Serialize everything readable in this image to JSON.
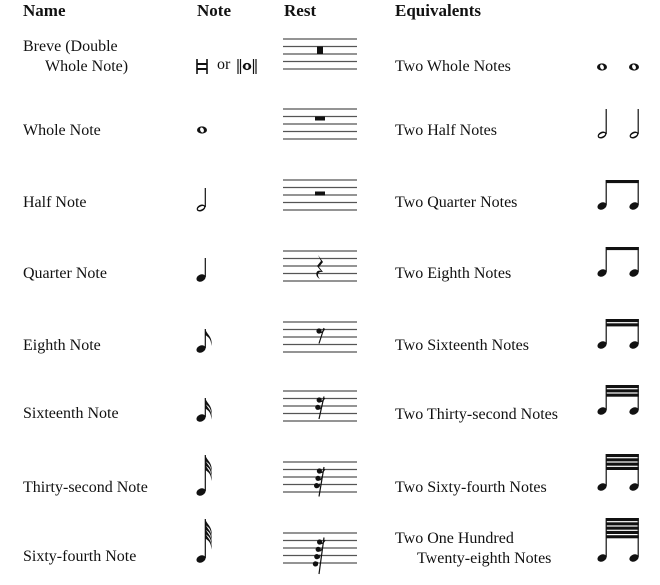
{
  "headers": {
    "name": "Name",
    "note": "Note",
    "rest": "Rest",
    "equivalents": "Equivalents"
  },
  "rows": [
    {
      "name_line1": "Breve (Double",
      "name_line2": "Whole Note)",
      "note_symbol": "breve-icon",
      "note_alt_connector": "or",
      "rest_symbol": "breve-rest-icon",
      "equivalent_line1": "Two Whole Notes",
      "equivalent_line2": "",
      "equivalent_symbol": "two-whole-notes-icon",
      "flags": -2
    },
    {
      "name_line1": "Whole Note",
      "name_line2": "",
      "note_symbol": "whole-note-icon",
      "rest_symbol": "whole-rest-icon",
      "equivalent_line1": "Two Half Notes",
      "equivalent_line2": "",
      "equivalent_symbol": "two-half-notes-icon",
      "flags": -1
    },
    {
      "name_line1": "Half Note",
      "name_line2": "",
      "note_symbol": "half-note-icon",
      "rest_symbol": "half-rest-icon",
      "equivalent_line1": "Two Quarter Notes",
      "equivalent_line2": "",
      "equivalent_symbol": "two-quarter-notes-icon",
      "flags": 0
    },
    {
      "name_line1": "Quarter Note",
      "name_line2": "",
      "note_symbol": "quarter-note-icon",
      "rest_symbol": "quarter-rest-icon",
      "equivalent_line1": "Two Eighth Notes",
      "equivalent_line2": "",
      "equivalent_symbol": "two-eighth-notes-icon",
      "flags": 0
    },
    {
      "name_line1": "Eighth Note",
      "name_line2": "",
      "note_symbol": "eighth-note-icon",
      "rest_symbol": "eighth-rest-icon",
      "equivalent_line1": "Two Sixteenth Notes",
      "equivalent_line2": "",
      "equivalent_symbol": "two-sixteenth-notes-icon",
      "flags": 1
    },
    {
      "name_line1": "Sixteenth Note",
      "name_line2": "",
      "note_symbol": "sixteenth-note-icon",
      "rest_symbol": "sixteenth-rest-icon",
      "equivalent_line1": "Two Thirty-second Notes",
      "equivalent_line2": "",
      "equivalent_symbol": "two-thirty-second-notes-icon",
      "flags": 2
    },
    {
      "name_line1": "Thirty-second Note",
      "name_line2": "",
      "note_symbol": "thirty-second-note-icon",
      "rest_symbol": "thirty-second-rest-icon",
      "equivalent_line1": "Two Sixty-fourth Notes",
      "equivalent_line2": "",
      "equivalent_symbol": "two-sixty-fourth-notes-icon",
      "flags": 3
    },
    {
      "name_line1": "Sixty-fourth Note",
      "name_line2": "",
      "note_symbol": "sixty-fourth-note-icon",
      "rest_symbol": "sixty-fourth-rest-icon",
      "equivalent_line1": "Two One Hundred",
      "equivalent_line2": "Twenty-eighth Notes",
      "equivalent_symbol": "two-one-hundred-twenty-eighth-notes-icon",
      "flags": 4
    }
  ],
  "colors": {
    "ink": "#111111",
    "staff_line": "#555555"
  }
}
